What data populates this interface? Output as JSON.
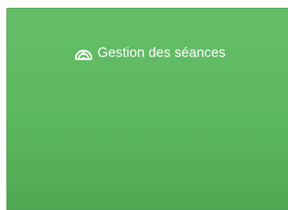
{
  "tile": {
    "title": "Gestion des séances",
    "icon": "group-icon",
    "background_color": "#5cb85c",
    "text_color": "#ffffff"
  }
}
